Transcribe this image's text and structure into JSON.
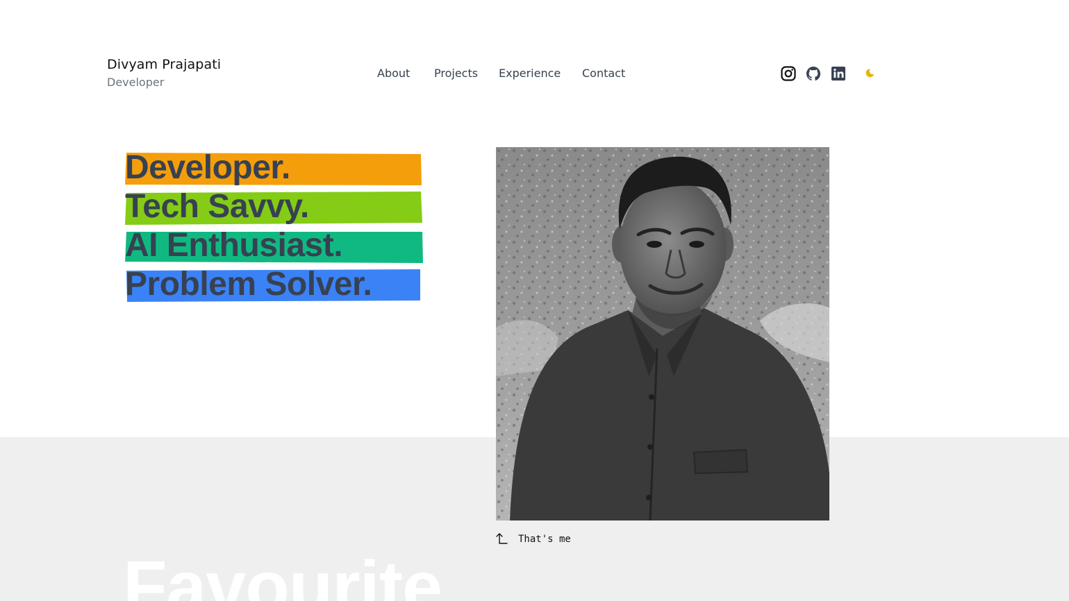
{
  "header": {
    "name": "Divyam Prajapati",
    "role": "Developer"
  },
  "nav": {
    "items": [
      {
        "label": "About"
      },
      {
        "label": "Projects"
      },
      {
        "label": "Experience"
      },
      {
        "label": "Contact"
      }
    ]
  },
  "social": {
    "icons": [
      "instagram-icon",
      "github-icon",
      "linkedin-icon"
    ],
    "theme_icon": "moon-icon",
    "theme_color": "#eab308"
  },
  "hero": {
    "lines": [
      {
        "text": "Developer.",
        "color": "#f59e0b"
      },
      {
        "text": "Tech Savvy.",
        "color": "#84cc16"
      },
      {
        "text": "AI Enthusiast.",
        "color": "#10b981"
      },
      {
        "text": "Problem Solver.",
        "color": "#3b82f6"
      }
    ]
  },
  "portrait": {
    "caption": "That's me"
  },
  "section": {
    "heading": "Favourite"
  }
}
